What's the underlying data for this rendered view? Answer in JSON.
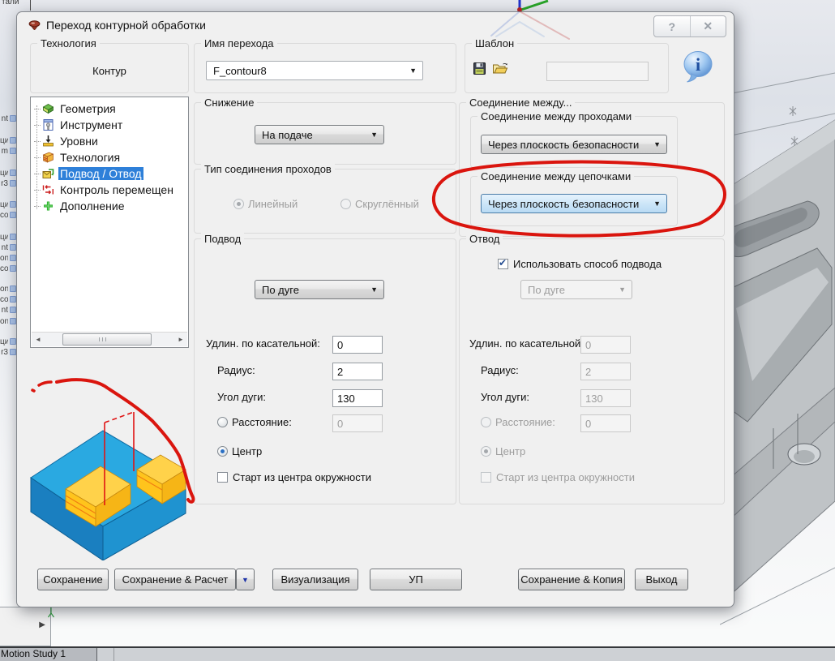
{
  "window": {
    "title": "Переход контурной обработки"
  },
  "icons": {
    "dropdown_arrow": "▼",
    "scroll_left": "◄",
    "scroll_right": "►",
    "check": "✔",
    "panel_arrow": "▶",
    "help": "?",
    "close": "✕",
    "info": "i"
  },
  "header": {
    "technology": {
      "label": "Технология",
      "value": "Контур"
    },
    "name": {
      "label": "Имя перехода",
      "value": "F_contour8"
    },
    "template": {
      "label": "Шаблон",
      "field_value": ""
    }
  },
  "tree": {
    "items": [
      {
        "label": "Геометрия",
        "icon": "geometry-icon",
        "selected": false
      },
      {
        "label": "Инструмент",
        "icon": "tool-icon",
        "selected": false
      },
      {
        "label": "Уровни",
        "icon": "levels-icon",
        "selected": false
      },
      {
        "label": "Технология",
        "icon": "technology-icon",
        "selected": false
      },
      {
        "label": "Подвод / Отвод",
        "icon": "approach-retract-icon",
        "selected": true
      },
      {
        "label": "Контроль перемещен",
        "icon": "motion-control-icon",
        "selected": false
      },
      {
        "label": "Дополнение",
        "icon": "addition-icon",
        "selected": false
      }
    ]
  },
  "descent": {
    "label": "Снижение",
    "value": "На подаче"
  },
  "pass_connection": {
    "label": "Тип соединения проходов",
    "options": [
      {
        "label": "Линейный",
        "selected": true,
        "enabled": false
      },
      {
        "label": "Скруглённый",
        "selected": false,
        "enabled": false
      }
    ]
  },
  "connections": {
    "label": "Соединение между...",
    "between_passes": {
      "label": "Соединение между проходами",
      "value": "Через плоскость безопасности"
    },
    "between_chains": {
      "label": "Соединение между цепочками",
      "value": "Через плоскость безопасности",
      "focused": true
    }
  },
  "approach": {
    "label": "Подвод",
    "method_value": "По дуге",
    "tangent": {
      "label": "Удлин. по касательной:",
      "value": "0"
    },
    "radius": {
      "label": "Радиус:",
      "value": "2"
    },
    "arc_angle": {
      "label": "Угол дуги:",
      "value": "130"
    },
    "distance": {
      "label": "Расстояние:",
      "value": "0",
      "selected": false
    },
    "center": {
      "label": "Центр",
      "selected": true
    },
    "start_from_center": {
      "label": "Старт из центра окружности",
      "checked": false
    }
  },
  "retract": {
    "label": "Отвод",
    "use_approach": {
      "label": "Использовать способ подвода",
      "checked": true
    },
    "method_value": "По дуге",
    "tangent": {
      "label": "Удлин. по касательной:",
      "value": "0"
    },
    "radius": {
      "label": "Радиус:",
      "value": "2"
    },
    "arc_angle": {
      "label": "Угол дуги:",
      "value": "130"
    },
    "distance": {
      "label": "Расстояние:",
      "value": "0",
      "selected": false
    },
    "center": {
      "label": "Центр",
      "selected": true
    },
    "start_from_center": {
      "label": "Старт из центра окружности",
      "checked": false
    }
  },
  "footer": {
    "save": "Сохранение",
    "save_calc": "Сохранение & Расчет",
    "visualization": "Визуализация",
    "nc": "УП",
    "save_copy": "Сохранение & Копия",
    "exit": "Выход"
  },
  "background": {
    "top_left_fragment": "тали",
    "motion_study_tab": "Motion Study 1",
    "left_fragments": [
      "nt",
      "ци",
      "m",
      "ци",
      "r3",
      "ци",
      "co",
      "ци",
      "nt",
      "on",
      "co",
      "on",
      "co",
      "nt",
      "on",
      "ци",
      "r3"
    ]
  },
  "colors": {
    "annotation_red": "#da150e",
    "selection_blue": "#2e80d9",
    "preview_blue": "#2aa9e1",
    "preview_yellow": "#ffc91c"
  }
}
